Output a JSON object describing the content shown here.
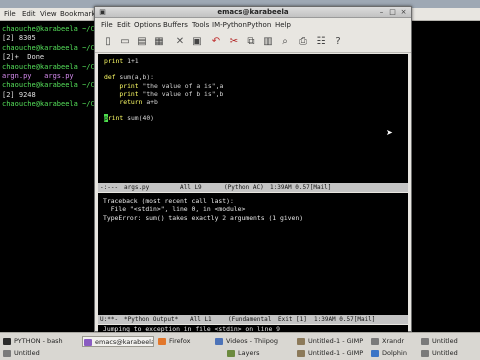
{
  "terminal": {
    "title": "PYTHON - bash",
    "menu": [
      "File",
      "Edit",
      "View",
      "Bookmarks"
    ],
    "lines": [
      {
        "text": "chaouche@karabeela ~/C",
        "kind": "prompt"
      },
      {
        "text": "[2] 8305",
        "kind": "plain"
      },
      {
        "text": "chaouche@karabeela ~/C",
        "kind": "prompt"
      },
      {
        "text": "[2]+  Done",
        "kind": "plain"
      },
      {
        "text": "chaouche@karabeela ~/C",
        "kind": "prompt"
      },
      {
        "text": "argn.py   args.py",
        "kind": "files"
      },
      {
        "text": "chaouche@karabeela ~/C",
        "kind": "prompt"
      },
      {
        "text": "[2] 9248",
        "kind": "plain"
      },
      {
        "text": "chaouche@karabeela ~/C",
        "kind": "prompt"
      }
    ]
  },
  "emacs": {
    "title": "emacs@karabeela",
    "menu": [
      "File",
      "Edit",
      "Options",
      "Buffers",
      "Tools",
      "IM-Python",
      "Python",
      "Help"
    ],
    "toolbar_icons": [
      "new-file-icon",
      "open-folder-icon",
      "open-file-icon",
      "save-icon",
      "close-icon",
      "save-as-icon",
      "undo-icon",
      "cut-icon",
      "copy-icon",
      "paste-icon",
      "search-icon",
      "print-icon",
      "preferences-icon",
      "help-icon"
    ],
    "code": [
      [
        {
          "t": "print",
          "c": "kw"
        },
        {
          "t": " 1+1",
          "c": "st"
        }
      ],
      [],
      [
        {
          "t": "def",
          "c": "kw"
        },
        {
          "t": " sum(a,b):",
          "c": "st"
        }
      ],
      [
        {
          "t": "    print",
          "c": "kw"
        },
        {
          "t": " \"the value of a is\",a",
          "c": "st"
        }
      ],
      [
        {
          "t": "    print",
          "c": "kw"
        },
        {
          "t": " \"the value of b is\",b",
          "c": "st"
        }
      ],
      [
        {
          "t": "    return",
          "c": "kw"
        },
        {
          "t": " a+b",
          "c": "st"
        }
      ],
      [],
      [
        {
          "t": "p",
          "c": "cursor"
        },
        {
          "t": "rint",
          "c": "kw"
        },
        {
          "t": " sum(40)",
          "c": "st"
        }
      ]
    ],
    "modeline_top": {
      "left": "-:---  ",
      "buffer": "args.py",
      "position": "All L9",
      "mode": "(Python AC)",
      "time": "1:39AM 0.57[Mail]"
    },
    "output_lines": [
      "Traceback (most recent call last):",
      "  File \"<stdin>\", line 0, in <module>",
      "TypeError: sum() takes exactly 2 arguments (1 given)"
    ],
    "modeline_bottom": {
      "left": "U:**-  ",
      "buffer": "*Python Output*",
      "position": "All L1",
      "mode": "(Fundamental",
      "status": "Exit [1]",
      "time": "1:39AM 0.57[Mail]"
    },
    "minibuffer": "Jumping to exception in file <stdin> on line 9"
  },
  "taskbar": {
    "items": [
      {
        "label": "PYTHON - bash",
        "color": "#2b2b2b",
        "active": false
      },
      {
        "label": "emacs@karabeela",
        "color": "#8a5cc2",
        "active": true
      },
      {
        "label": "Firefox",
        "color": "#e2772b",
        "active": false
      },
      {
        "label": "Videos - Thiipog",
        "color": "#4d73b8",
        "active": false
      },
      {
        "label": "Layers",
        "color": "#6b8a3e",
        "active": false
      },
      {
        "label": "Untitled-1 - GIMP",
        "color": "#8c7a5a",
        "active": false
      },
      {
        "label": "Xrandr",
        "color": "#7a7a7a",
        "active": false
      },
      {
        "label": "Untitled-1 - GIMP",
        "color": "#8c7a5a",
        "active": false
      },
      {
        "label": "Dolphin",
        "color": "#3a74c6",
        "active": false
      },
      {
        "label": "Untitled",
        "color": "#7a7a7a",
        "active": false
      },
      {
        "label": "Untitled",
        "color": "#7a7a7a",
        "active": false
      },
      {
        "label": "Untitled",
        "color": "#7a7a7a",
        "active": false
      }
    ]
  },
  "colors": {
    "keyword": "#ffff66",
    "cursor": "#4ee04e",
    "prompt": "#55e05a"
  }
}
